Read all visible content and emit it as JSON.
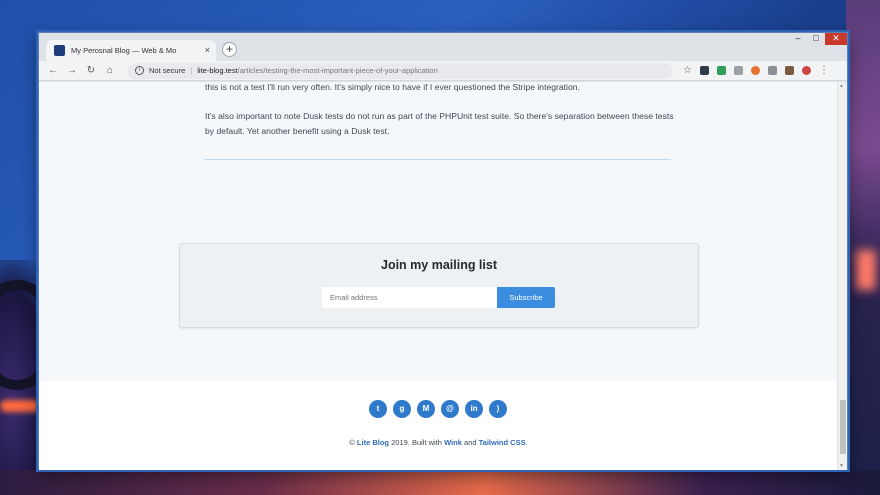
{
  "browser": {
    "tab_title": "My Perosnal Blog — Web & Mo",
    "tab_close": "×",
    "new_tab": "+",
    "minimize": "–",
    "maximize": "□",
    "close": "✕",
    "security_label": "Not secure",
    "url_host": "lite-blog.test",
    "url_path": "/articles/testing-the-most-important-piece-of-your-application",
    "colors": {
      "accent": "#3b8de0",
      "close": "#c7392b"
    }
  },
  "article": {
    "paragraph_1": "this is not a test I'll run very often. It's simply nice to have if I ever questioned the Stripe integration.",
    "paragraph_2": "It's also important to note Dusk tests do not run as part of the PHPUnit test suite. So there's separation between these tests by default. Yet another benefit using a Dusk test."
  },
  "mailing": {
    "title": "Join my mailing list",
    "email_placeholder": "Email address",
    "subscribe_label": "Subscribe"
  },
  "footer": {
    "social_icons": [
      "twitter-icon",
      "github-icon",
      "medium-icon",
      "email-icon",
      "linkedin-icon",
      "rss-icon"
    ],
    "social_glyphs": [
      "t",
      "g",
      "M",
      "@",
      "in",
      ")"
    ],
    "copyright_prefix": "©",
    "brand": "Lite Blog",
    "year_text": "2019.  Built with",
    "wink": "Wink",
    "and_text": "and",
    "tailwind": "Tailwind CSS",
    "period": "."
  }
}
